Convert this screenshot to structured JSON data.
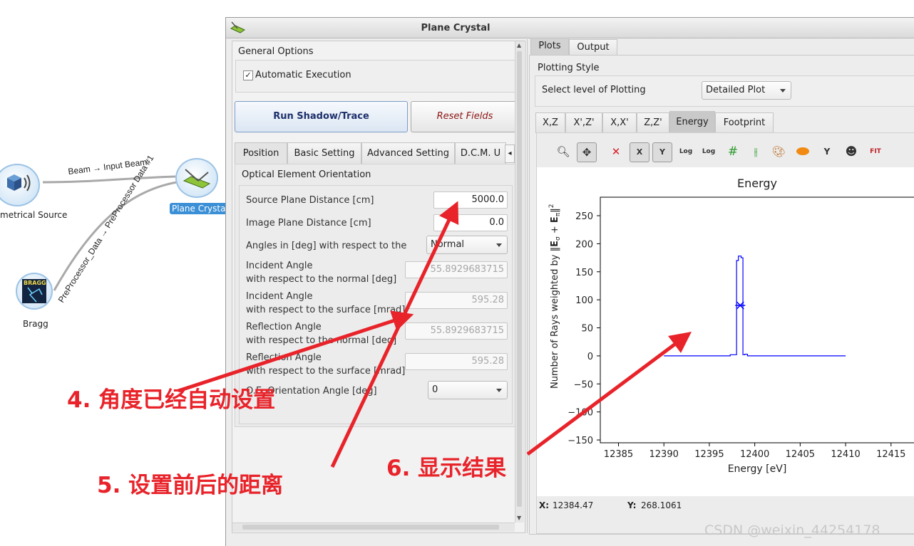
{
  "canvas": {
    "nodes": {
      "source": "metrical Source",
      "crystal": "Plane Crystal",
      "bragg": "Bragg"
    },
    "bragg_logo_text": "BRAGG",
    "links": {
      "beam": "Beam → Input Beam",
      "preprocessor": "PreProcessor_Data → PreProcessor Data #1"
    }
  },
  "window": {
    "title": "Plane Crystal",
    "icon": "plane-crystal-widget-icon"
  },
  "left": {
    "general_options": "General Options",
    "auto_exec": "Automatic Execution",
    "auto_exec_checked": true,
    "run_button": "Run Shadow/Trace",
    "reset_button": "Reset Fields",
    "tabs": [
      "Position",
      "Basic Setting",
      "Advanced Setting",
      "D.C.M. U"
    ],
    "section_title": "Optical Element Orientation",
    "rows": {
      "source_dist_label": "Source Plane Distance [cm]",
      "source_dist_value": "5000.0",
      "image_dist_label": "Image Plane Distance [cm]",
      "image_dist_value": "0.0",
      "angles_label": "Angles in [deg] with respect to the",
      "angles_value": "Normal",
      "inc_normal_l1": "Incident Angle",
      "inc_normal_l2": "with respect to the normal [deg]",
      "inc_normal_value": "55.8929683715",
      "inc_surface_l1": "Incident Angle",
      "inc_surface_l2": "with respect to the surface [mrad]",
      "inc_surface_value": "595.28",
      "refl_normal_l1": "Reflection Angle",
      "refl_normal_l2": "with respect to the normal [deg]",
      "refl_normal_value": "55.8929683715",
      "refl_surface_l1": "Reflection Angle",
      "refl_surface_l2": "with respect to the surface [mrad]",
      "refl_surface_value": "595.28",
      "orientation_label": "O.E. Orientation Angle [deg]",
      "orientation_value": "0"
    }
  },
  "right": {
    "tabs": [
      "Plots",
      "Output"
    ],
    "plotting_style": "Plotting Style",
    "select_level_label": "Select level of Plotting",
    "select_level_value": "Detailed Plot",
    "plot_tabs": [
      "X,Z",
      "X',Z'",
      "X,X'",
      "Z,Z'",
      "Energy",
      "Footprint"
    ],
    "active_plot_tab": "Energy",
    "toolbar_icons": [
      "zoom-icon",
      "pan-icon",
      "clear-icon",
      "x-range-icon",
      "y-range-icon",
      "log-x-icon",
      "log-y-icon",
      "grid-icon",
      "adjust-icon",
      "colormap-icon",
      "shape-icon",
      "y-axis-icon",
      "mask-icon",
      "fit-icon"
    ],
    "coords": {
      "x_label": "X:",
      "x_value": "12384.47",
      "y_label": "Y:",
      "y_value": "268.1061"
    }
  },
  "chart_data": {
    "type": "line",
    "title": "Energy",
    "xlabel": "Energy [eV]",
    "ylabel_prefix": "Number of Rays weighted by ",
    "xlim": [
      12383,
      12418
    ],
    "ylim": [
      -155,
      283
    ],
    "x_ticks": [
      "12385",
      "12390",
      "12395",
      "12400",
      "12405",
      "12410",
      "12415"
    ],
    "y_ticks": [
      "250",
      "200",
      "150",
      "100",
      "50",
      "0",
      "−50",
      "−100",
      "−150"
    ],
    "x_tick_values": [
      12385,
      12390,
      12395,
      12400,
      12405,
      12410,
      12415
    ],
    "y_tick_values": [
      250,
      200,
      150,
      100,
      50,
      0,
      -50,
      -100,
      -150
    ],
    "series": [
      {
        "color": "#0000ff",
        "x": [
          12390,
          12397.3,
          12397.3,
          12398.0,
          12398.0,
          12398.2,
          12398.2,
          12398.5,
          12398.5,
          12398.7,
          12398.7,
          12398.9,
          12398.9,
          12399.2,
          12399.2,
          12410
        ],
        "y": [
          0,
          0,
          2,
          2,
          170,
          170,
          178,
          178,
          175,
          175,
          2,
          2,
          3,
          3,
          0,
          0
        ]
      }
    ],
    "marker": {
      "x": 12398.4,
      "y": 90
    }
  },
  "annotations": {
    "a4": "4. 角度已经自动设置",
    "a5": "5. 设置前后的距离",
    "a6": "6. 显示结果",
    "color": "#e8232a"
  },
  "watermark": "CSDN @weixin_44254178"
}
